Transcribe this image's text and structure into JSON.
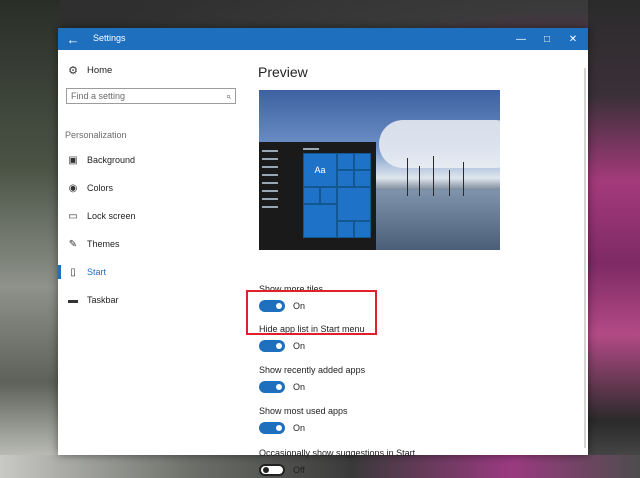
{
  "window": {
    "title": "Settings",
    "back_icon": "back-arrow-icon",
    "controls": {
      "minimize": "—",
      "maximize": "□",
      "close": "✕"
    }
  },
  "sidebar": {
    "home_label": "Home",
    "search_placeholder": "Find a setting",
    "section_label": "Personalization",
    "items": [
      {
        "label": "Background",
        "icon": "picture-icon",
        "active": false
      },
      {
        "label": "Colors",
        "icon": "palette-icon",
        "active": false
      },
      {
        "label": "Lock screen",
        "icon": "lock-screen-icon",
        "active": false
      },
      {
        "label": "Themes",
        "icon": "themes-icon",
        "active": false
      },
      {
        "label": "Start",
        "icon": "start-icon",
        "active": true
      },
      {
        "label": "Taskbar",
        "icon": "taskbar-icon",
        "active": false
      }
    ]
  },
  "main": {
    "preview_title": "Preview",
    "preview_tile_text": "Aa",
    "settings": [
      {
        "label": "Show more tiles",
        "state": "On"
      },
      {
        "label": "Hide app list in Start menu",
        "state": "On"
      },
      {
        "label": "Show recently added apps",
        "state": "On"
      },
      {
        "label": "Show most used apps",
        "state": "On"
      },
      {
        "label": "Occasionally show suggestions in Start",
        "state": "Off"
      }
    ]
  },
  "colors": {
    "accent": "#1f6fbf",
    "highlight": "#e0202a"
  }
}
